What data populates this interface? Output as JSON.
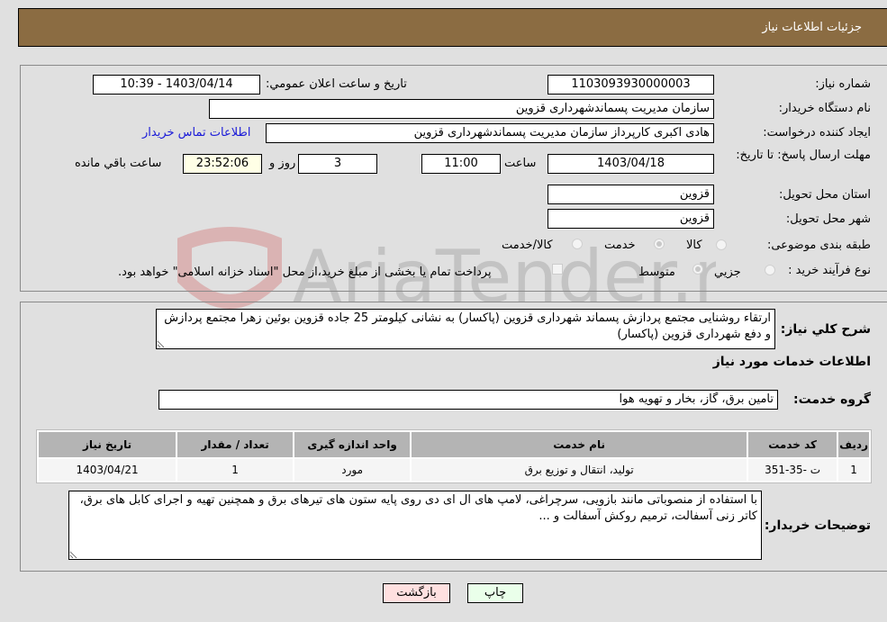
{
  "header": {
    "title": "جزئیات اطلاعات نیاز"
  },
  "info": {
    "need_number_label": "شماره نیاز:",
    "need_number": "1103093930000003",
    "announce_label": "تاریخ و ساعت اعلان عمومي:",
    "announce_value": "1403/04/14 - 10:39",
    "buyer_org_label": "نام دستگاه خريدار:",
    "buyer_org": "سازمان مدیریت پسماندشهرداری قزوین",
    "creator_label": "ایجاد کننده درخواست:",
    "creator": "هادی اکبری کارپرداز سازمان مدیریت پسماندشهرداری قزوین",
    "contact_link": "اطلاعات تماس خریدار",
    "deadline_label": "مهلت ارسال پاسخ: تا تاریخ:",
    "deadline_date": "1403/04/18",
    "time_label": "ساعت",
    "deadline_time": "11:00",
    "days_value": "3",
    "days_label": "روز و",
    "remaining_time": "23:52:06",
    "remaining_label": "ساعت باقي مانده",
    "province_label": "استان محل تحویل:",
    "province": "قزوین",
    "city_label": "شهر محل تحویل:",
    "city": "قزوین",
    "category_label": "طبقه بندی موضوعی:",
    "category_options": [
      {
        "label": "کالا",
        "checked": false
      },
      {
        "label": "خدمت",
        "checked": true
      },
      {
        "label": "کالا/خدمت",
        "checked": false
      }
    ],
    "process_label": "نوع فرآیند خرید :",
    "process_options": [
      {
        "label": "جزيي",
        "checked": false
      },
      {
        "label": "متوسط",
        "checked": true
      }
    ],
    "treasury_note": "پرداخت تمام یا بخشی از مبلغ خرید،از محل \"اسناد خزانه اسلامی\" خواهد بود."
  },
  "details": {
    "description_label": "شرح كلي نياز:",
    "description": "ارتقاء روشنایی مجتمع پردازش پسماند شهرداری قزوین (پاکسار) به نشانی کیلومتر 25 جاده قزوین بوئین زهرا مجتمع پردازش و دفع شهرداری قزوین (پاکسار)",
    "services_heading": "اطلاعات خدمات مورد نیاز",
    "service_group_label": "گروه خدمت:",
    "service_group": "تامین برق، گاز، بخار و تهویه هوا",
    "table": {
      "headers": [
        "ردیف",
        "کد خدمت",
        "نام خدمت",
        "واحد اندازه گیری",
        "تعداد / مقدار",
        "تاریخ نیاز"
      ],
      "rows": [
        [
          "1",
          "ت -35-351",
          "تولید، انتقال و توزیع برق",
          "مورد",
          "1",
          "1403/04/21"
        ]
      ]
    },
    "buyer_notes_label": "توضیحات خریدار:",
    "buyer_notes": "با استفاده از منصوباتی مانند بازویی، سرچراغی، لامپ های ال ای دی روی پایه ستون های تیرهای برق و همچنین تهیه و اجرای کابل های برق، کاتر زنی آسفالت، ترمیم روکش آسفالت و ..."
  },
  "buttons": {
    "print": "چاپ",
    "back": "بازگشت"
  },
  "watermark": {
    "text": "AriaTender.neT"
  }
}
